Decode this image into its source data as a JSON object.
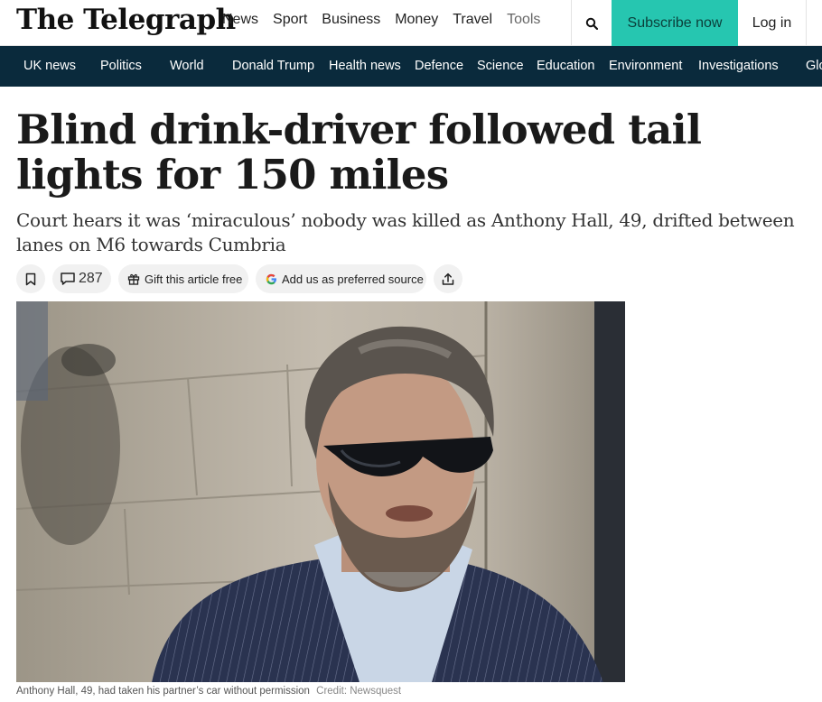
{
  "brand": {
    "logo": "The Telegraph"
  },
  "top_nav": {
    "items": [
      "News",
      "Sport",
      "Business",
      "Money",
      "Travel",
      "Tools"
    ],
    "active": "News"
  },
  "header_actions": {
    "search_icon": "search-icon",
    "subscribe": "Subscribe now",
    "login": "Log in"
  },
  "section_nav": {
    "items": [
      "UK news",
      "Politics",
      "World",
      "Donald Trump",
      "Health news",
      "Defence",
      "Science",
      "Education",
      "Environment",
      "Investigations",
      "Glo"
    ]
  },
  "article": {
    "headline": "Blind drink-driver followed tail lights for 150 miles",
    "standfirst": "Court hears it was ‘miraculous’ nobody was killed as Anthony Hall, 49, drifted between lanes on M6 towards Cumbria",
    "comment_count": "287",
    "gift_label": "Gift this article free",
    "preferred_source_label": "Add us as preferred source",
    "image_caption": "Anthony Hall, 49, had taken his partner’s car without permission",
    "image_credit": "Credit: Newsquest"
  },
  "colors": {
    "accent": "#26c6b0",
    "nav_bg": "#0a2a3c"
  }
}
